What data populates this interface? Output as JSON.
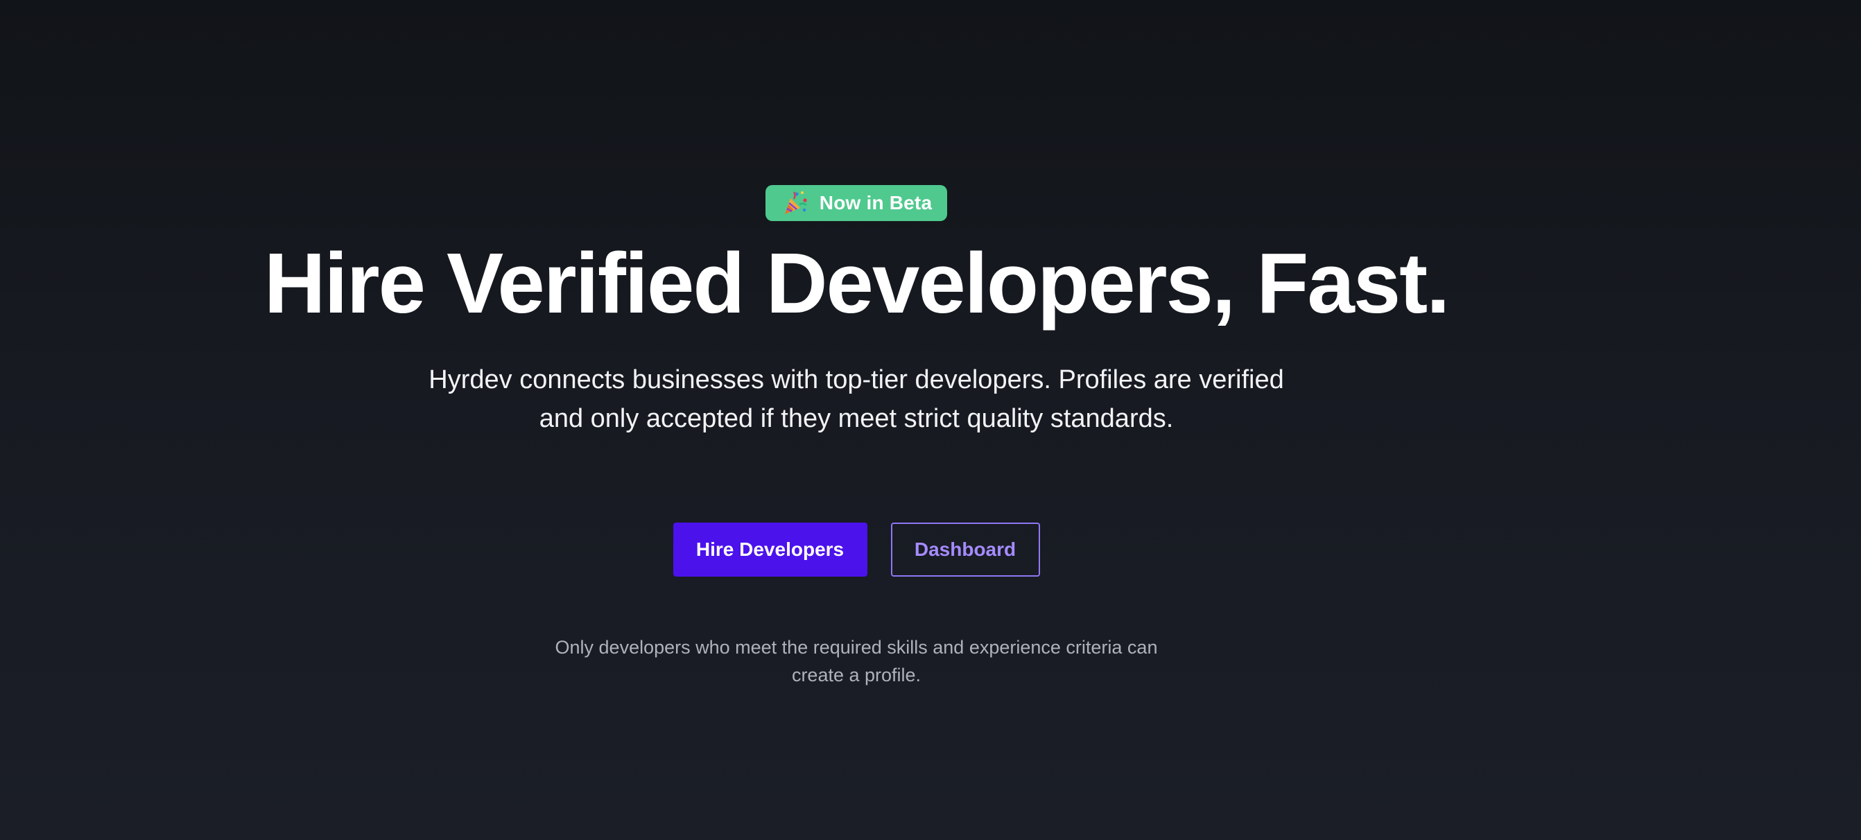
{
  "badge": {
    "icon": "party-popper-icon",
    "label": "Now in Beta",
    "color": "#4fc98e"
  },
  "hero": {
    "headline": "Hire Verified Developers, Fast.",
    "description": "Hyrdev connects businesses with top-tier developers. Profiles are verified and only accepted if they meet strict quality standards."
  },
  "actions": {
    "primary_label": "Hire Developers",
    "primary_color": "#4b12ec",
    "secondary_label": "Dashboard",
    "secondary_color": "#a58bff"
  },
  "note": "Only developers who meet the required skills and experience criteria can create a profile."
}
